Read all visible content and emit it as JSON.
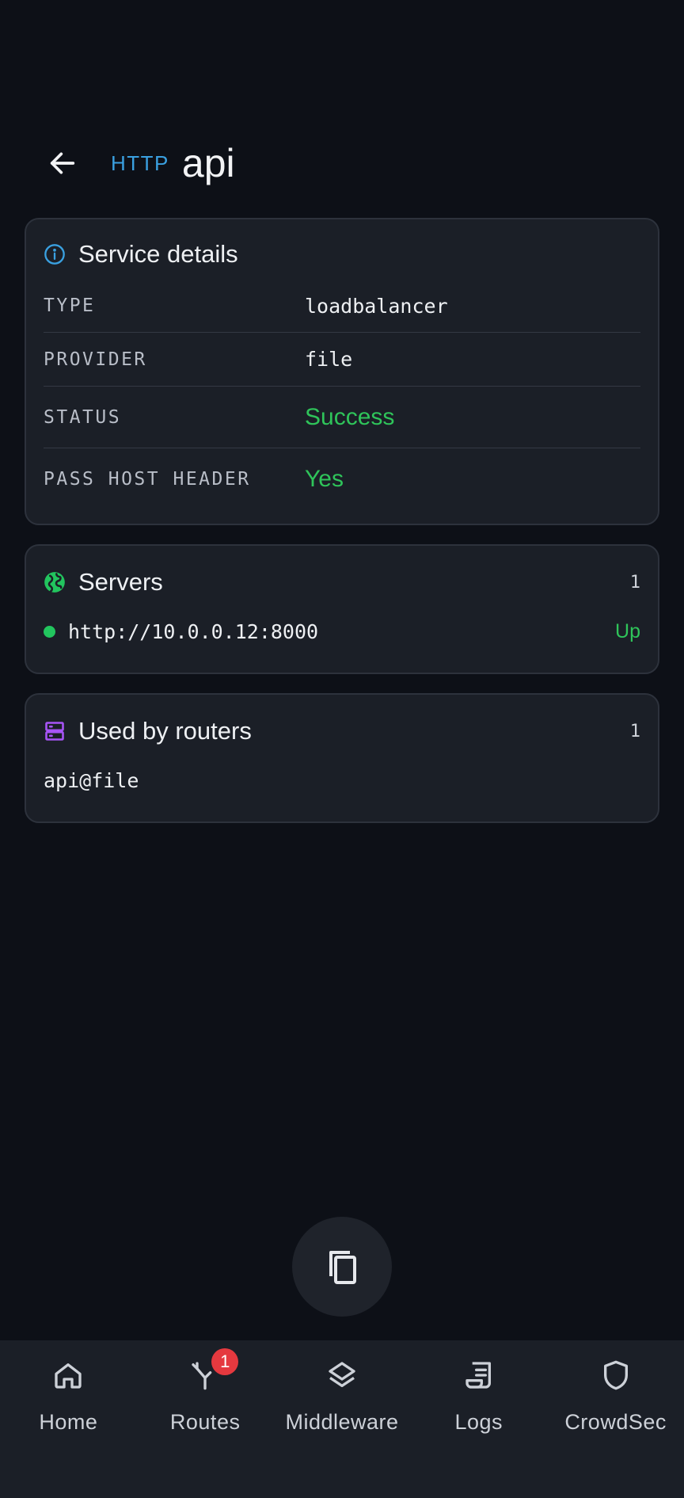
{
  "header": {
    "back_icon": "arrow-left-icon",
    "protocol": "HTTP",
    "title": "api"
  },
  "service_details": {
    "icon": "info-circle-icon",
    "title": "Service details",
    "rows": [
      {
        "key": "TYPE",
        "value": "loadbalancer",
        "style": "mono"
      },
      {
        "key": "PROVIDER",
        "value": "file",
        "style": "mono"
      },
      {
        "key": "STATUS",
        "value": "Success",
        "style": "ok"
      },
      {
        "key": "PASS HOST HEADER",
        "value": "Yes",
        "style": "ok"
      }
    ]
  },
  "servers": {
    "icon": "globe-icon",
    "title": "Servers",
    "count": "1",
    "items": [
      {
        "url": "http://10.0.0.12:8000",
        "status": "Up"
      }
    ]
  },
  "routers": {
    "icon": "server-icon",
    "title": "Used by routers",
    "count": "1",
    "items": [
      "api@file"
    ]
  },
  "fab": {
    "icon": "copy-icon"
  },
  "nav": [
    {
      "label": "Home",
      "icon": "home-icon"
    },
    {
      "label": "Routes",
      "icon": "routes-icon",
      "badge": "1"
    },
    {
      "label": "Middleware",
      "icon": "layers-icon"
    },
    {
      "label": "Logs",
      "icon": "logs-icon"
    },
    {
      "label": "CrowdSec",
      "icon": "shield-icon"
    }
  ],
  "colors": {
    "background": "#0d1017",
    "card": "#1b1f27",
    "accent_blue": "#3aa0e0",
    "success_green": "#2fc45a",
    "routers_purple": "#a855f7",
    "badge_red": "#e5393f"
  }
}
